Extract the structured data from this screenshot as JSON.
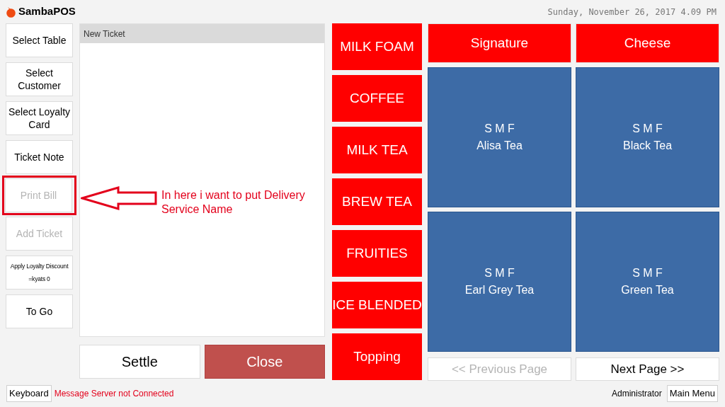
{
  "app": {
    "name": "SambaPOS",
    "datetime": "Sunday, November 26, 2017 4.09 PM"
  },
  "left_buttons": [
    {
      "label": "Select Table",
      "disabled": false,
      "highlighted": false,
      "kind": "normal"
    },
    {
      "label": "Select Customer",
      "disabled": false,
      "highlighted": false,
      "kind": "normal"
    },
    {
      "label": "Select Loyalty Card",
      "disabled": false,
      "highlighted": false,
      "kind": "normal"
    },
    {
      "label": "Ticket Note",
      "disabled": false,
      "highlighted": false,
      "kind": "normal"
    },
    {
      "label": "Print Bill",
      "disabled": true,
      "highlighted": true,
      "kind": "normal"
    },
    {
      "label": "Add Ticket",
      "disabled": true,
      "highlighted": false,
      "kind": "normal"
    },
    {
      "label": "Apply Loyalty Discount =kyats 0",
      "disabled": false,
      "highlighted": false,
      "kind": "small"
    },
    {
      "label": "To Go",
      "disabled": false,
      "highlighted": false,
      "kind": "normal"
    }
  ],
  "ticket": {
    "title": "New Ticket",
    "annotation": "In here i want to put Delivery Service Name"
  },
  "ticket_buttons": [
    {
      "label": "Settle",
      "kind": "plain"
    },
    {
      "label": "Close",
      "kind": "danger"
    }
  ],
  "categories": [
    "MILK FOAM",
    "COFFEE",
    "MILK TEA",
    "BREW TEA",
    "FRUITIES",
    "ICE BLENDED",
    "Topping"
  ],
  "product_groups": [
    "Signature",
    "Cheese"
  ],
  "products": [
    {
      "portions": "S M F",
      "name": "Alisa Tea"
    },
    {
      "portions": "S M F",
      "name": "Black Tea"
    },
    {
      "portions": "S M F",
      "name": "Earl Grey Tea"
    },
    {
      "portions": "S M F",
      "name": "Green Tea"
    }
  ],
  "paging": [
    {
      "label": "<< Previous Page",
      "disabled": true
    },
    {
      "label": "Next Page >>",
      "disabled": false
    }
  ],
  "status_bar": {
    "keyboard": "Keyboard",
    "message": "Message Server not Connected",
    "user": "Administrator",
    "main_menu": "Main Menu"
  }
}
